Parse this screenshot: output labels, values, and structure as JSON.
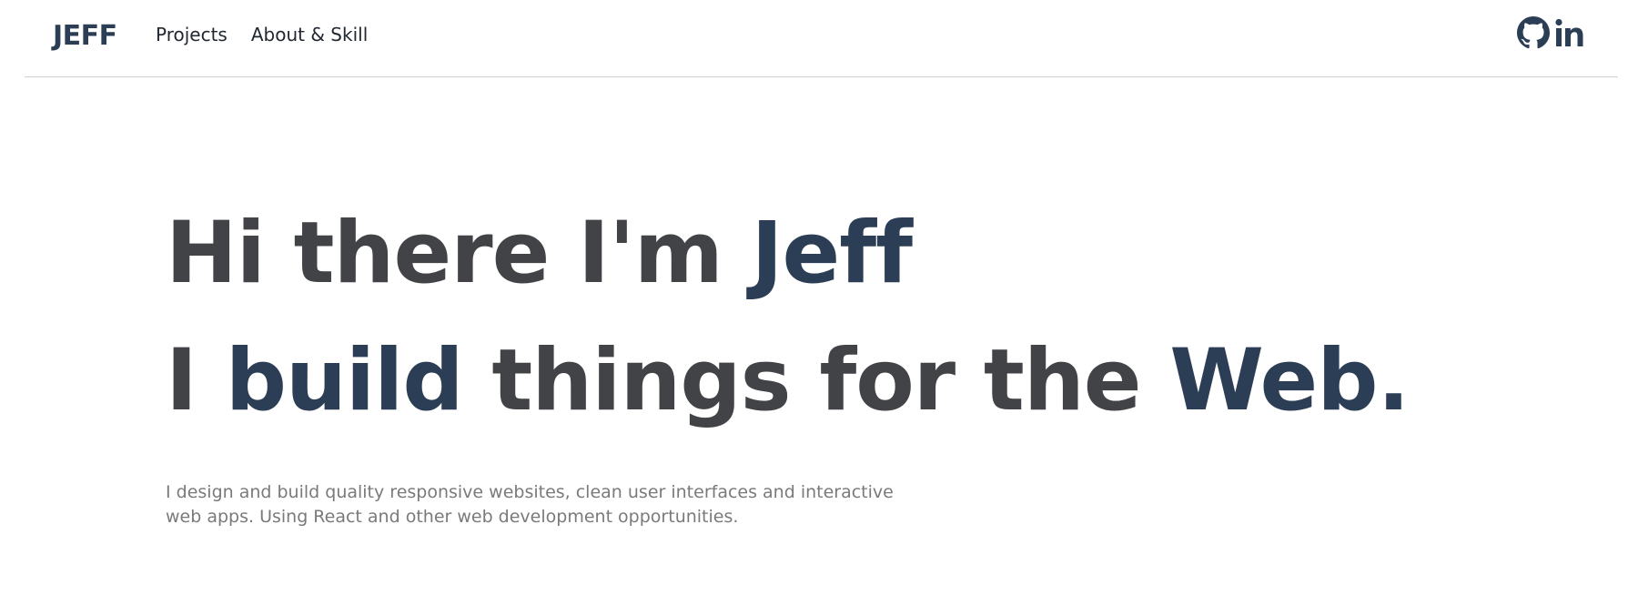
{
  "nav": {
    "logo": "JEFF",
    "links": [
      {
        "label": "Projects"
      },
      {
        "label": "About & Skill"
      }
    ],
    "social": [
      {
        "icon": "github-icon"
      },
      {
        "icon": "linkedin-icon",
        "label": "in"
      }
    ]
  },
  "hero": {
    "line1_part1": "Hi there I'm ",
    "line1_name": "Jeff",
    "line2_first": "I ",
    "line2_build": "build",
    "line2_middle": " things for the ",
    "line2_web": "Web.",
    "description": "I design and build quality responsive websites, clean user interfaces and interactive web apps. Using React and other web development opportunities."
  },
  "colors": {
    "accent": "#2c3e55",
    "heading": "#424347",
    "body_text": "#7a7a7a",
    "divider": "#cfcfcf"
  }
}
